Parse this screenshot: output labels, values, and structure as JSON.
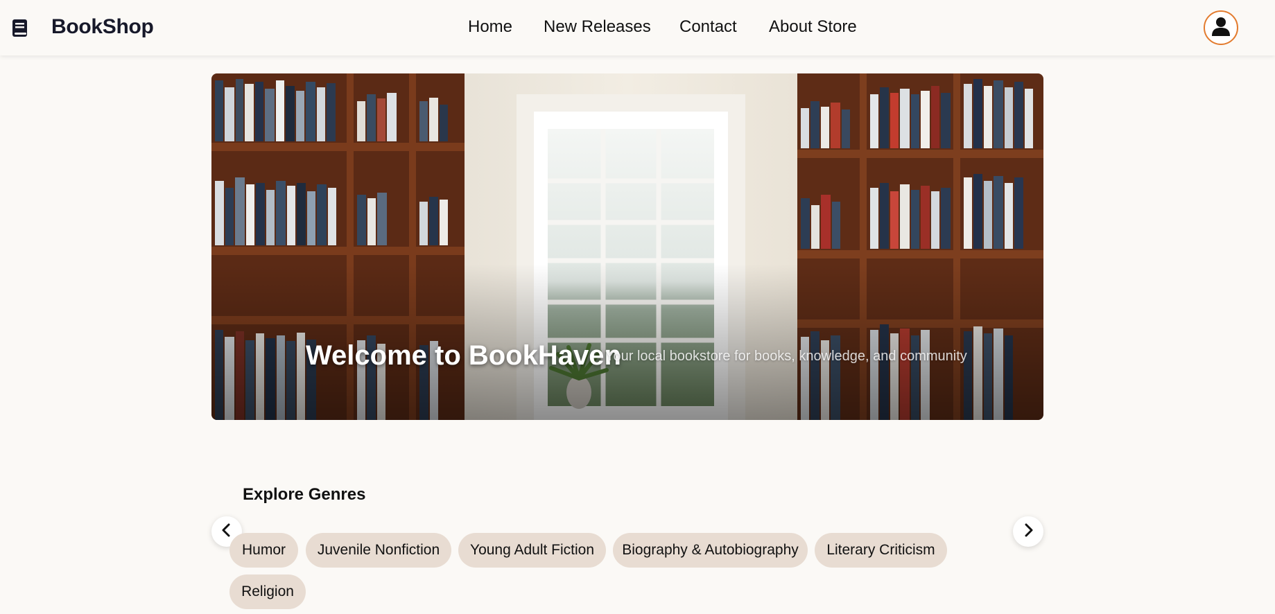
{
  "header": {
    "brand": "BookShop",
    "logo_icon": "book-icon",
    "nav": [
      {
        "label": "Home"
      },
      {
        "label": "New Releases"
      },
      {
        "label": "Contact"
      },
      {
        "label": "About Store"
      }
    ],
    "profile_icon": "user-icon",
    "accent_color": "#e37b2e"
  },
  "hero": {
    "title": "Welcome to BookHaven",
    "subtitle": "Your local bookstore for books, knowledge, and community"
  },
  "genres": {
    "title": "Explore Genres",
    "prev_icon": "chevron-left-icon",
    "next_icon": "chevron-right-icon",
    "items": [
      {
        "label": "Humor"
      },
      {
        "label": "Juvenile Nonfiction"
      },
      {
        "label": "Young Adult Fiction"
      },
      {
        "label": "Biography & Autobiography"
      },
      {
        "label": "Literary Criticism"
      },
      {
        "label": "Religion"
      }
    ],
    "chip_color": "#e8dcd2"
  }
}
